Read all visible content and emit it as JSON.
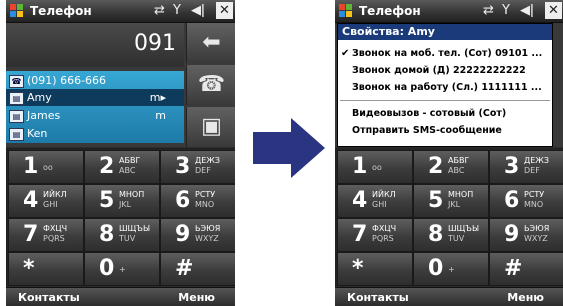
{
  "left_screen": {
    "title": "Телефон",
    "dialed": "091",
    "matches": [
      {
        "number": "(091) 666-666",
        "type": ""
      },
      {
        "name": "Amy",
        "type": "m"
      },
      {
        "name": "James",
        "type": "m"
      },
      {
        "name": "Ken",
        "type": ""
      }
    ],
    "side_buttons": [
      "backspace-arrow",
      "call",
      "video-call"
    ],
    "softkeys": {
      "left": "Контакты",
      "right": "Меню"
    }
  },
  "right_screen": {
    "title": "Телефон",
    "menu": {
      "header": "Свойства: Amy",
      "items": [
        "Звонок на моб. тел. (Сот) 09101 ...",
        "Звонок домой (Д) 22222222222",
        "Звонок на работу (Сл.) 1111111 ...",
        "Видеовызов - сотовый (Сот)",
        "Отправить SMS-сообщение"
      ],
      "checked_index": 0
    },
    "softkeys": {
      "left": "Контакты",
      "right": "Меню"
    }
  },
  "keypad": [
    {
      "digit": "1",
      "letters": "",
      "latin": "oo"
    },
    {
      "digit": "2",
      "letters": "АБВГ",
      "latin": "ABC"
    },
    {
      "digit": "3",
      "letters": "ДЕЖЗ",
      "latin": "DEF"
    },
    {
      "digit": "4",
      "letters": "ИЙКЛ",
      "latin": "GHI"
    },
    {
      "digit": "5",
      "letters": "МНОП",
      "latin": "JKL"
    },
    {
      "digit": "6",
      "letters": "РСТУ",
      "latin": "MNO"
    },
    {
      "digit": "7",
      "letters": "ФХЦЧ",
      "latin": "PQRS"
    },
    {
      "digit": "8",
      "letters": "ШЩЪЫ",
      "latin": "TUV"
    },
    {
      "digit": "9",
      "letters": "ЬЭЮЯ",
      "latin": "WXYZ"
    },
    {
      "digit": "*",
      "letters": "",
      "latin": ""
    },
    {
      "digit": "0",
      "letters": "",
      "latin": "+"
    },
    {
      "digit": "#",
      "letters": "",
      "latin": ""
    }
  ],
  "colors": {
    "menu_header": "#1a3a7a",
    "match_highlight": "#1e7aa8",
    "arrow": "#2b3480"
  }
}
